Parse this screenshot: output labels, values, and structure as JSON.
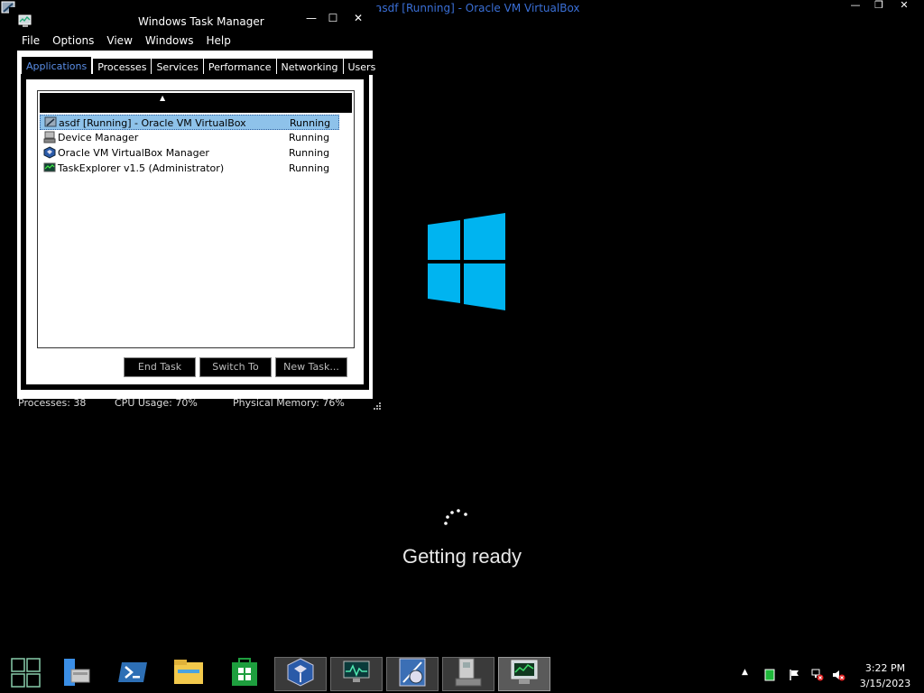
{
  "vbox": {
    "title": "asdf [Running] - Oracle VM VirtualBox",
    "minimize_glyph": "—",
    "restore_glyph": "❐",
    "close_glyph": "✕"
  },
  "task_manager": {
    "title": "Windows Task Manager",
    "minimize_glyph": "—",
    "maximize_glyph": "☐",
    "close_glyph": "✕",
    "menu": [
      "File",
      "Options",
      "View",
      "Windows",
      "Help"
    ],
    "tabs": [
      "Applications",
      "Processes",
      "Services",
      "Performance",
      "Networking",
      "Users"
    ],
    "active_tab": "Applications",
    "sort_arrow": "▲",
    "applications": [
      {
        "name": "asdf [Running] - Oracle VM VirtualBox",
        "status": "Running",
        "icon": "virtualbox-vm-icon",
        "selected": true
      },
      {
        "name": "Device Manager",
        "status": "Running",
        "icon": "device-manager-icon",
        "selected": false
      },
      {
        "name": "Oracle VM VirtualBox Manager",
        "status": "Running",
        "icon": "virtualbox-manager-icon",
        "selected": false
      },
      {
        "name": "TaskExplorer v1.5 (Administrator)",
        "status": "Running",
        "icon": "task-explorer-icon",
        "selected": false
      }
    ],
    "buttons": {
      "end_task": "End Task",
      "switch_to": "Switch To",
      "new_task": "New Task..."
    },
    "status": {
      "processes": "Processes: 38",
      "cpu": "CPU Usage: 70%",
      "memory": "Physical Memory: 76%"
    }
  },
  "boot": {
    "message": "Getting ready",
    "logo_color": "#00b4f0"
  },
  "taskbar": {
    "apps": [
      {
        "icon": "start-tiles-icon"
      },
      {
        "icon": "server-manager-icon"
      },
      {
        "icon": "powershell-icon"
      },
      {
        "icon": "file-explorer-icon"
      },
      {
        "icon": "store-icon"
      },
      {
        "icon": "virtualbox-icon"
      },
      {
        "icon": "system-monitor-icon"
      },
      {
        "icon": "system-informer-icon"
      },
      {
        "icon": "device-manager-icon"
      },
      {
        "icon": "task-manager-icon"
      }
    ],
    "tray": {
      "show_hidden_glyph": "▲",
      "time": "3:22 PM",
      "date": "3/15/2023"
    }
  },
  "colors": {
    "accent_blue": "#5b8fe8",
    "selection": "#8ec2ea",
    "logo": "#00b4f0"
  }
}
